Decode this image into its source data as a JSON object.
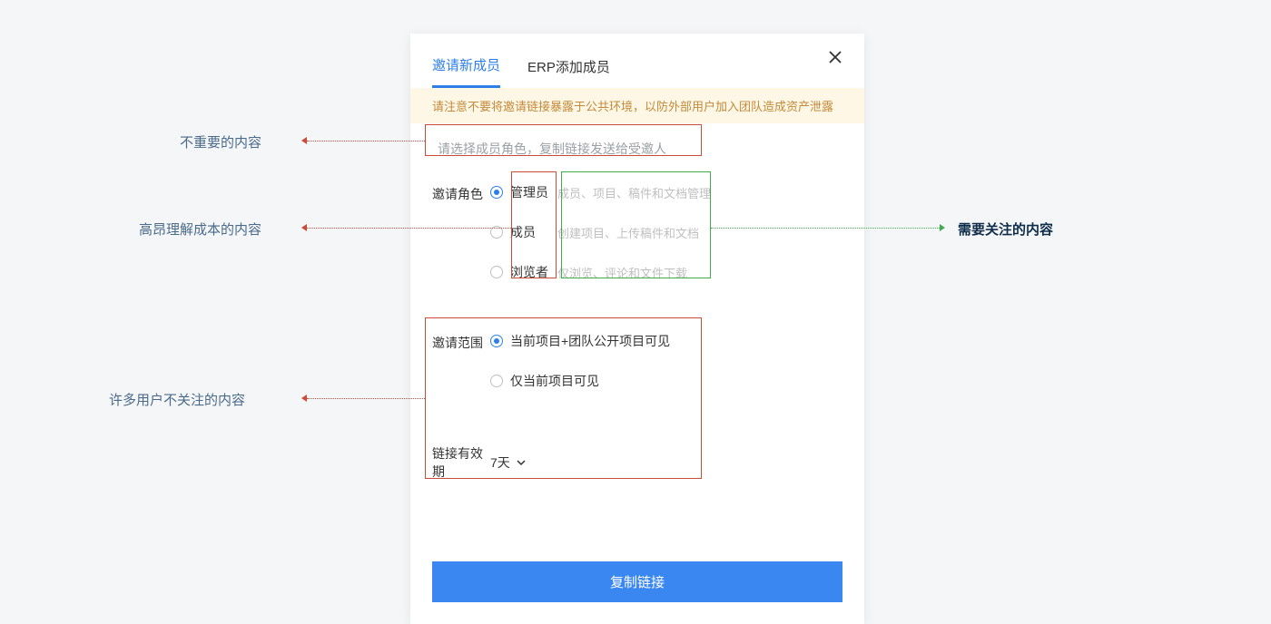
{
  "tabs": {
    "invite": "邀请新成员",
    "erp": "ERP添加成员"
  },
  "warning": "请注意不要将邀请链接暴露于公共环境，以防外部用户加入团队造成资产泄露",
  "hint": "请选择成员角色，复制链接发送给受邀人",
  "role": {
    "label": "邀请角色",
    "options": [
      {
        "name": "管理员",
        "desc": "成员、项目、稿件和文档管理"
      },
      {
        "name": "成员",
        "desc": "创建项目、上传稿件和文档"
      },
      {
        "name": "浏览者",
        "desc": "仅浏览、评论和文件下载"
      }
    ]
  },
  "scope": {
    "label": "邀请范围",
    "options": [
      {
        "name": "当前项目+团队公开项目可见"
      },
      {
        "name": "仅当前项目可见"
      }
    ]
  },
  "expiry": {
    "label": "链接有效期",
    "value": "7天"
  },
  "cta": "复制链接",
  "annotations": {
    "unimportant": "不重要的内容",
    "costly": "高昂理解成本的内容",
    "ignored": "许多用户不关注的内容",
    "focus": "需要关注的内容"
  }
}
